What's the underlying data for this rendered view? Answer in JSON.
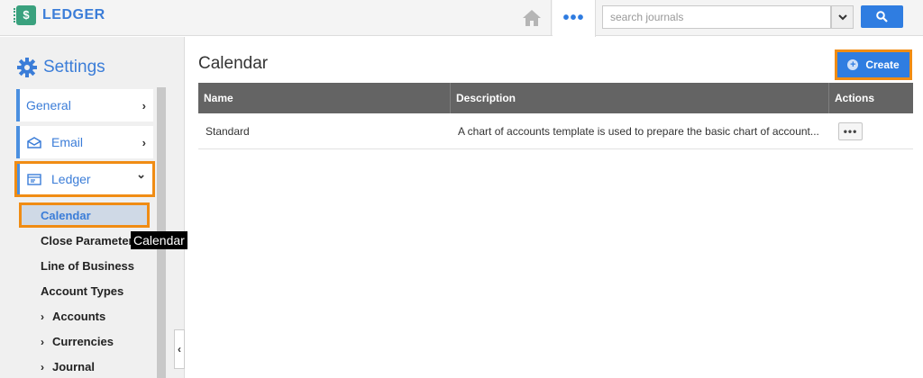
{
  "app": {
    "logo_glyph": "$",
    "name": "LEDGER"
  },
  "topbar": {
    "more_label": "•••",
    "search_placeholder": "search journals"
  },
  "sidebar": {
    "title": "Settings",
    "cards": [
      {
        "label": "General",
        "chevron": "›"
      },
      {
        "label": "Email",
        "chevron": "›"
      },
      {
        "label": "Ledger",
        "chevron": "⌄"
      }
    ],
    "active_sub_item": "Calendar",
    "sub_items": [
      {
        "label": "Close Parameters"
      },
      {
        "label": "Line of Business"
      },
      {
        "label": "Account Types"
      },
      {
        "label": "Accounts",
        "arrow": "›"
      },
      {
        "label": "Currencies",
        "arrow": "›"
      },
      {
        "label": "Journal",
        "arrow": "›"
      }
    ],
    "tooltip": "Calendar",
    "collapse_glyph": "‹"
  },
  "main": {
    "title": "Calendar",
    "create_label": "Create",
    "create_glyph": "+",
    "table": {
      "headers": [
        "Name",
        "Description",
        "Actions"
      ],
      "rows": [
        {
          "name": "Standard",
          "description": "A chart of accounts template is used to prepare the basic chart of account...",
          "actions": "•••"
        }
      ]
    }
  },
  "colors": {
    "brand_blue": "#2f7de1",
    "highlight_orange": "#f08c14",
    "table_header": "#646464",
    "logo_green": "#3aa17e"
  }
}
